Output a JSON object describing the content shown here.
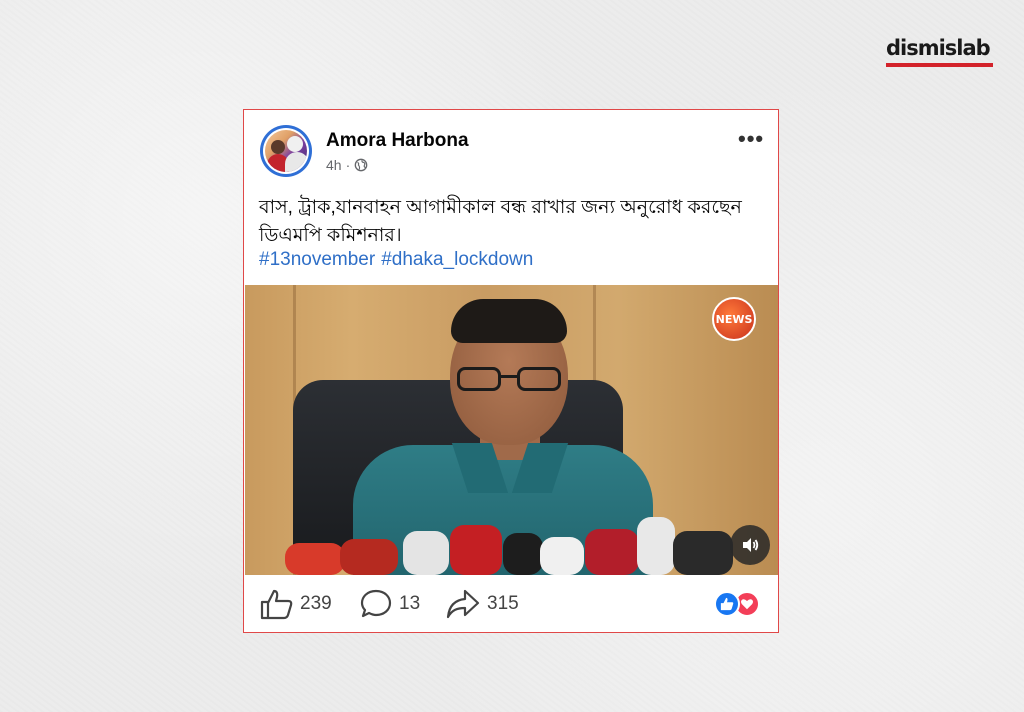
{
  "brand": {
    "name": "dismislab",
    "accent": "#d3222a"
  },
  "post": {
    "author": "Amora Harbona",
    "time": "4h",
    "separator": "·",
    "audience_icon": "globe-icon",
    "more_label": "•••",
    "text": "বাস, ট্রাক,যানবাহন আগামীকাল বন্ধ রাখার জন্য অনুরোধ করছেন ডিএমপি কমিশনার।",
    "hashtags": [
      "#13november",
      "#dhaka_lockdown"
    ],
    "video": {
      "channel_logo": "NEWS",
      "sound_icon": "speaker-icon"
    },
    "counts": {
      "likes": "239",
      "comments": "13",
      "shares": "315"
    },
    "reactions": [
      "like",
      "love"
    ]
  },
  "colors": {
    "link": "#2f6fc7",
    "like": "#1877f2",
    "love": "#f33e58",
    "card_border": "#e04848"
  }
}
